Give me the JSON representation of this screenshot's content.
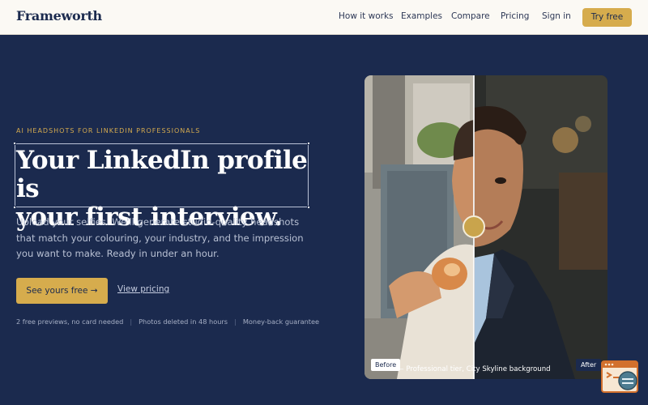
{
  "header": {
    "logo": "Frameworth",
    "nav": [
      "How it works",
      "Examples",
      "Compare",
      "Pricing",
      "Sign in"
    ],
    "cta": "Try free"
  },
  "hero": {
    "eyebrow": "AI HEADSHOTS FOR LINKEDIN PROFESSIONALS",
    "headline_line1": "Your LinkedIn profile is",
    "headline_line2": "your first interview.",
    "subcopy": "Upload your selfies. We'll generate studio-quality headshots that match your colouring, your industry, and the impression you want to make. Ready in under an hour.",
    "primary_cta": "See yours free →",
    "secondary_cta": "View pricing",
    "trust": [
      "2 free previews, no card needed",
      "Photos deleted in 48 hours",
      "Money-back guarantee"
    ]
  },
  "comparison": {
    "before_label": "Before",
    "after_label": "After",
    "caption": "— Professional tier, City Skyline background"
  },
  "colors": {
    "navy": "#1b2a4e",
    "gold": "#d6ac4d",
    "cream": "#fbf9f4"
  }
}
